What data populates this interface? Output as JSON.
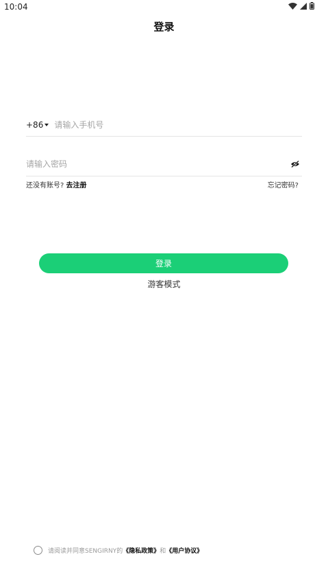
{
  "status_bar": {
    "time": "10:04",
    "icons": [
      "wifi-icon",
      "signal-icon",
      "battery-icon"
    ]
  },
  "header": {
    "title": "登录"
  },
  "phone": {
    "country_code": "+86",
    "placeholder": "请输入手机号",
    "value": ""
  },
  "password": {
    "placeholder": "请输入密码",
    "value": "",
    "toggle_icon": "eye-off-icon"
  },
  "links": {
    "register_prefix": "还没有账号?",
    "register": "去注册",
    "forgot": "忘记密码?"
  },
  "login_button": {
    "label": "登录"
  },
  "guest_mode": {
    "label": "游客模式"
  },
  "agreement": {
    "prefix": "请阅读并同意SENGIRNY的",
    "privacy": "《隐私政策》",
    "and": "和",
    "terms": "《用户协议》",
    "checked": false
  },
  "colors": {
    "accent": "#1bcf77",
    "divider": "#e4e4e4",
    "placeholder": "#a6a6a6"
  }
}
